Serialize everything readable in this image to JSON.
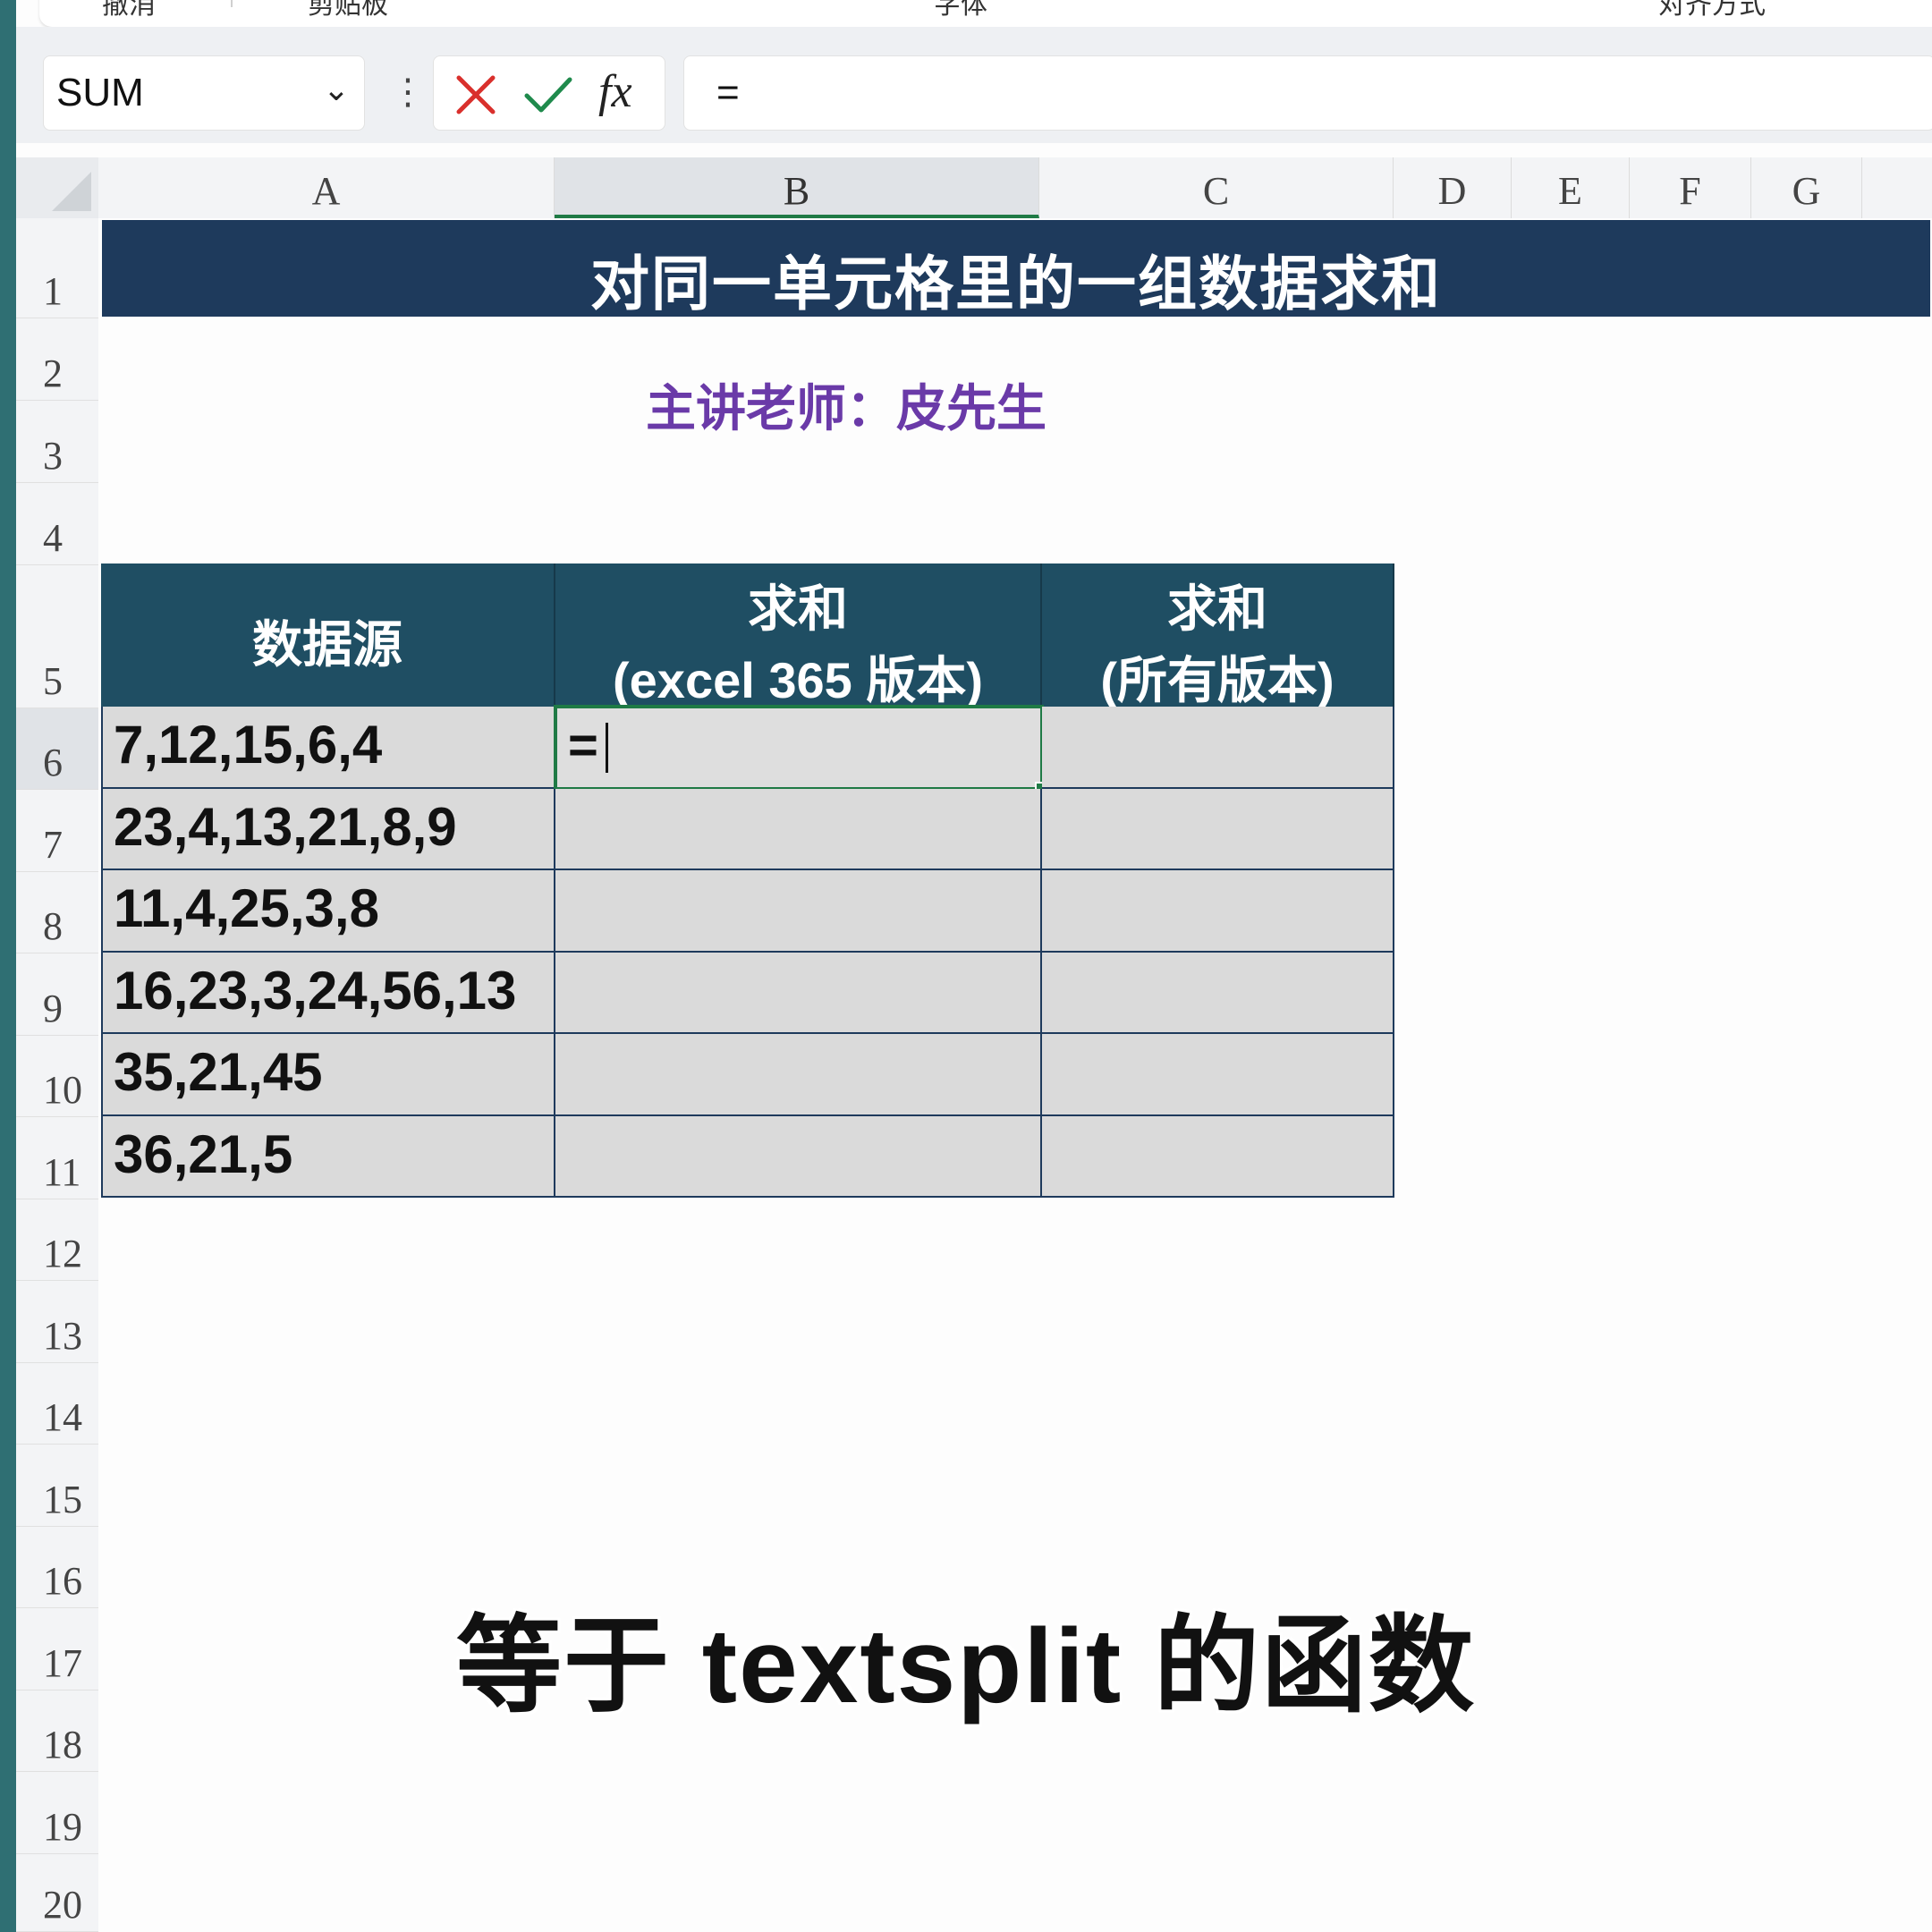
{
  "ribbon": {
    "labels": [
      "撤消",
      "剪贴板",
      "字体",
      "对齐方式"
    ]
  },
  "formula_bar": {
    "name_box": "SUM",
    "formula": "=",
    "fx_label": "fx"
  },
  "columns": [
    "A",
    "B",
    "C",
    "D",
    "E",
    "F",
    "G"
  ],
  "rows": [
    "1",
    "2",
    "3",
    "4",
    "5",
    "6",
    "7",
    "8",
    "9",
    "10",
    "11",
    "12",
    "13",
    "14",
    "15",
    "16",
    "17",
    "18",
    "19",
    "20"
  ],
  "sheet": {
    "title": "对同一单元格里的一组数据求和",
    "teacher": "主讲老师：皮先生",
    "table": {
      "headers": [
        {
          "line1": "数据源",
          "line2": ""
        },
        {
          "line1": "求和",
          "line2": "(excel 365 版本)"
        },
        {
          "line1": "求和",
          "line2": "(所有版本)"
        }
      ],
      "data": [
        "7,12,15,6,4",
        "23,4,13,21,8,9",
        "11,4,25,3,8",
        "16,23,3,24,56,13",
        "35,21,45",
        "36,21,5"
      ],
      "active_cell": {
        "ref": "B6",
        "value": "="
      }
    }
  },
  "subtitle": "等于 textsplit 的函数",
  "colors": {
    "title_bg": "#1e3a5c",
    "header_bg": "#1f4e63",
    "teacher_text": "#6a3aa8",
    "selection": "#1f7a45",
    "cell_bg": "#dadada"
  }
}
